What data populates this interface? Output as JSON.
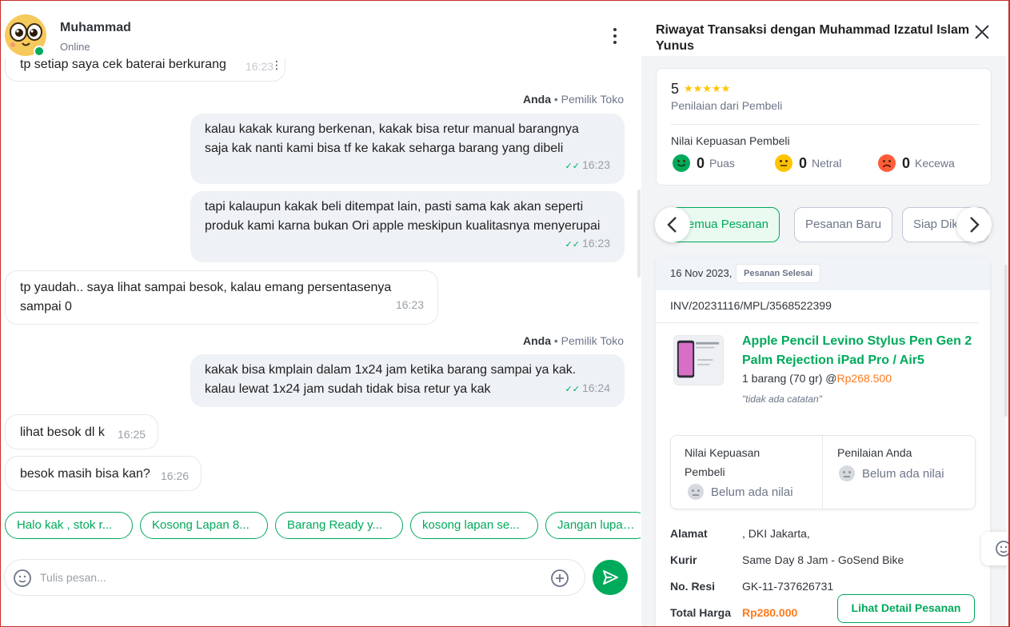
{
  "header": {
    "name": "Muhammad",
    "status": "Online"
  },
  "messages": {
    "m0": {
      "text": "tp setiap saya cek baterai berkurang",
      "time": "16:23"
    },
    "sender1": {
      "name": "Anda",
      "role": "• Pemilik Toko"
    },
    "m1": {
      "text": "kalau kakak kurang berkenan, kakak bisa retur manual barangnya saja kak nanti kami bisa tf ke kakak seharga barang yang dibeli",
      "time": "16:23"
    },
    "m2": {
      "text": "tapi kalaupun kakak beli ditempat lain, pasti sama kak akan seperti produk kami karna bukan Ori apple meskipun kualitasnya menyerupai",
      "time": "16:23"
    },
    "m3": {
      "text": "tp yaudah.. saya lihat sampai besok, kalau emang persentasenya sampai 0",
      "time": "16:23"
    },
    "sender2": {
      "name": "Anda",
      "role": "• Pemilik Toko"
    },
    "m4": {
      "text": "kakak bisa kmplain dalam 1x24 jam ketika barang sampai ya kak. kalau lewat 1x24 jam sudah tidak bisa retur ya kak",
      "time": "16:24"
    },
    "m5": {
      "text": "lihat besok dl k",
      "time": "16:25"
    },
    "m6": {
      "text": "besok masih bisa kan?",
      "time": "16:26"
    }
  },
  "quick_replies": [
    "Halo kak , stok r...",
    "Kosong Lapan 8...",
    "Barang Ready y...",
    "kosong lapan se...",
    "Jangan lupa Kli"
  ],
  "composer": {
    "placeholder": "Tulis pesan..."
  },
  "panel": {
    "title": "Riwayat Transaksi dengan Muhammad Izzatul Islam Yunus",
    "rating": {
      "score": "5",
      "stars": "★★★★★",
      "subtitle": "Penilaian dari Pembeli",
      "satisfaction_title": "Nilai Kepuasan Pembeli",
      "puas": {
        "count": "0",
        "label": "Puas"
      },
      "netral": {
        "count": "0",
        "label": "Netral"
      },
      "kecewa": {
        "count": "0",
        "label": "Kecewa"
      }
    },
    "tabs": [
      "Semua Pesanan",
      "Pesanan Baru",
      "Siap Dikirim"
    ],
    "order": {
      "date": "16 Nov 2023,",
      "status": "Pesanan Selesai",
      "invoice": "INV/20231116/MPL/3568522399",
      "product_name": "Apple Pencil Levino Stylus Pen Gen 2 Palm Rejection iPad Pro / Air5",
      "qty": "1 barang (70 gr) @",
      "price": "Rp268.500",
      "note": "\"tidak ada catatan\"",
      "buyer_satisfaction_title": "Nilai Kepuasan Pembeli",
      "buyer_satisfaction_value": "Belum ada nilai",
      "your_rating_title": "Penilaian Anda",
      "your_rating_value": "Belum ada nilai",
      "address_label": "Alamat",
      "address_value": ", DKI Jakarta,",
      "courier_label": "Kurir",
      "courier_value": "Same Day 8 Jam - GoSend Bike",
      "resi_label": "No. Resi",
      "resi_value": "GK-11-737626731",
      "total_label": "Total Harga",
      "total_value": "Rp280.000",
      "detail_button": "Lihat Detail Pesanan"
    }
  },
  "colors": {
    "accent": "#00aa5b",
    "price": "#ff7a1a",
    "star": "#ffc400",
    "frame": "#c4302b"
  }
}
